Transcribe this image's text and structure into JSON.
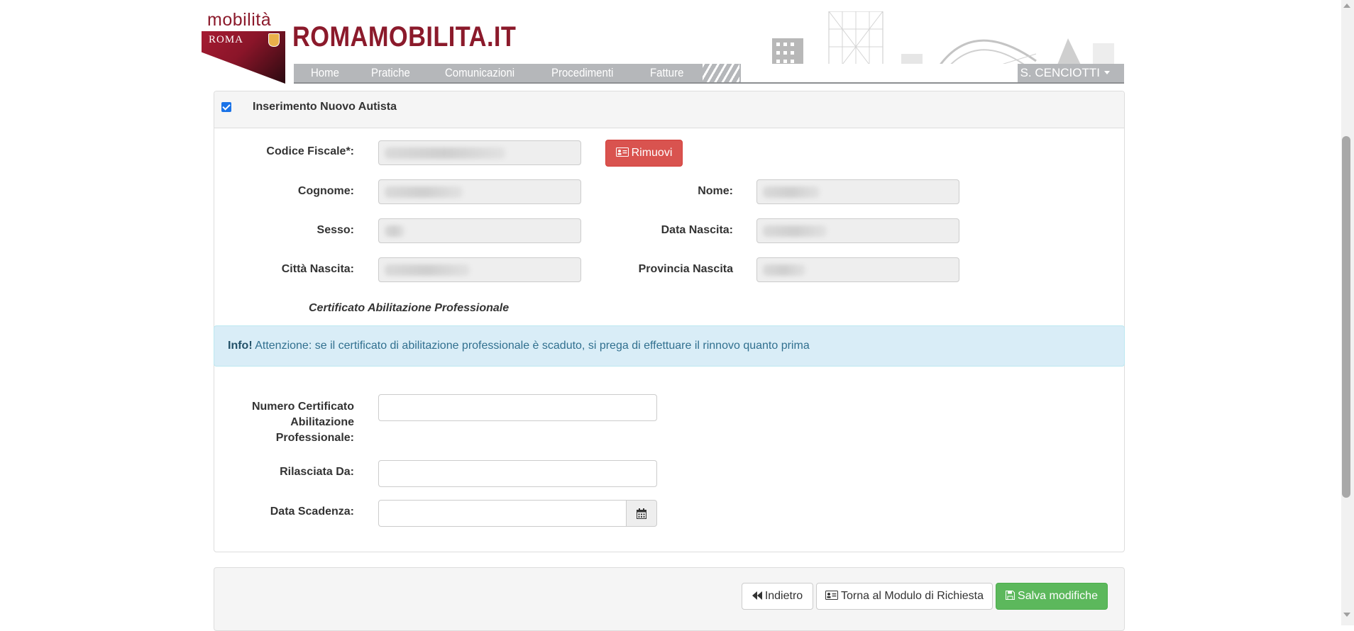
{
  "header": {
    "logo_word": "mobilità",
    "logo_city": "ROMA",
    "brand": "ROMAMOBILITA.IT",
    "nav": [
      "Home",
      "Pratiche",
      "Comunicazioni",
      "Procedimenti",
      "Fatture"
    ],
    "user": "S. CENCIOTTI"
  },
  "panel": {
    "title": "Inserimento Nuovo Autista",
    "checked": true,
    "fields": {
      "codice_fiscale_label": "Codice Fiscale*:",
      "cognome_label": "Cognome:",
      "nome_label": "Nome:",
      "sesso_label": "Sesso:",
      "data_nascita_label": "Data Nascita:",
      "citta_nascita_label": "Città Nascita:",
      "provincia_nascita_label": "Provincia Nascita"
    },
    "remove_button": "Rimuovi",
    "section_title": "Certificato Abilitazione Professionale",
    "alert": {
      "strong": "Info!",
      "text": " Attenzione: se il certificato di abilitazione professionale è scaduto, si prega di effettuare il rinnovo quanto prima"
    },
    "cert_fields": {
      "numero_label_l1": "Numero Certificato",
      "numero_label_l2": "Abilitazione",
      "numero_label_l3": "Professionale:",
      "rilasciata_label": "Rilasciata Da:",
      "scadenza_label": "Data Scadenza:"
    }
  },
  "footer": {
    "back_button": "Indietro",
    "module_button": "Torna al Modulo di Richiesta",
    "save_button": "Salva modifiche"
  },
  "colors": {
    "brand": "#8b1a2b",
    "danger": "#d9534f",
    "success": "#5cb85c",
    "info_bg": "#d9edf7",
    "info_text": "#31708f"
  }
}
